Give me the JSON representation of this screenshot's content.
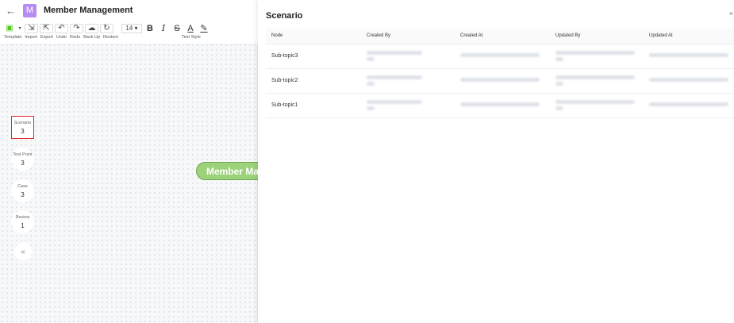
{
  "header": {
    "back_icon": "back-arrow-icon",
    "app_badge": "M",
    "title": "Member Management"
  },
  "toolbar": {
    "labels": [
      "Template",
      "Import",
      "Export",
      "Undo",
      "Redo",
      "Back Up",
      "Restore"
    ],
    "font_size": "14",
    "text_style_label": "Text Style"
  },
  "stats": [
    {
      "label": "Scenario",
      "value": "3"
    },
    {
      "label": "Test Point",
      "value": "3"
    },
    {
      "label": "Case",
      "value": "3"
    },
    {
      "label": "Review",
      "value": "1"
    }
  ],
  "collapse_label": "«",
  "root_node": "Member Management",
  "drawer": {
    "title": "Scenario",
    "close_label": "×",
    "columns": [
      "Node",
      "Created By",
      "Created At",
      "Updated By",
      "Updated At"
    ],
    "rows": [
      {
        "node": "Sub-topic3"
      },
      {
        "node": "Sub-topic2"
      },
      {
        "node": "Sub-topic1"
      }
    ]
  },
  "colors": {
    "accent": "#b68cf0",
    "highlight": "#e0262d",
    "node_fill": "#9cd27a"
  }
}
